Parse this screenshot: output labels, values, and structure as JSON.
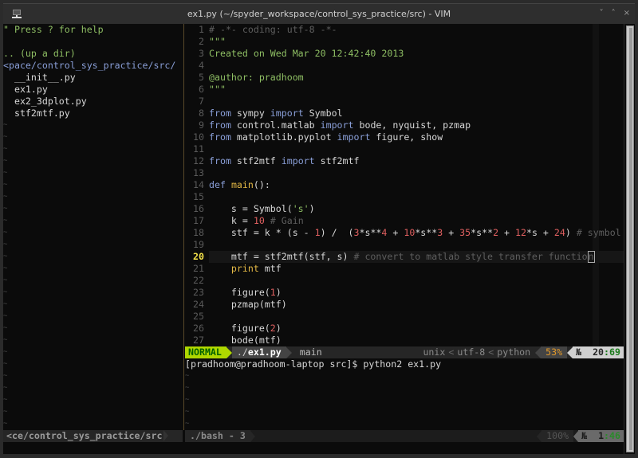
{
  "window": {
    "title": "ex1.py (~/spyder_workspace/control_sys_practice/src) - VIM",
    "controls": {
      "minimize": "˅",
      "maximize": "˄",
      "close": "×"
    }
  },
  "tree": {
    "help": "\" Press ? for help",
    "updir": ".. (up a dir)",
    "cwd": "<pace/control_sys_practice/src/",
    "files": [
      "  __init__.py",
      "  ex1.py",
      "  ex2_3dplot.py",
      "  stf2mtf.py"
    ],
    "tilde": "~"
  },
  "editor": {
    "current_line": 20,
    "lines": [
      {
        "n": "1",
        "tokens": [
          {
            "t": "# -*- coding: utf-8 -*-",
            "c": "com"
          }
        ]
      },
      {
        "n": "2",
        "tokens": [
          {
            "t": "\"\"\"",
            "c": "str"
          }
        ]
      },
      {
        "n": "3",
        "tokens": [
          {
            "t": "Created on Wed Mar 20 12:42:40 2013",
            "c": "str"
          }
        ]
      },
      {
        "n": "4",
        "tokens": []
      },
      {
        "n": "5",
        "tokens": [
          {
            "t": "@author: pradhoom",
            "c": "str"
          }
        ]
      },
      {
        "n": "6",
        "tokens": [
          {
            "t": "\"\"\"",
            "c": "str"
          }
        ]
      },
      {
        "n": "7",
        "tokens": []
      },
      {
        "n": "8",
        "tokens": [
          {
            "t": "from",
            "c": "kw"
          },
          {
            "t": " sympy ",
            "c": "pl"
          },
          {
            "t": "import",
            "c": "kw"
          },
          {
            "t": " Symbol",
            "c": "pl"
          }
        ]
      },
      {
        "n": "9",
        "tokens": [
          {
            "t": "from",
            "c": "kw"
          },
          {
            "t": " control.matlab ",
            "c": "pl"
          },
          {
            "t": "import",
            "c": "kw"
          },
          {
            "t": " bode, nyquist, pzmap",
            "c": "pl"
          }
        ]
      },
      {
        "n": "10",
        "tokens": [
          {
            "t": "from",
            "c": "kw"
          },
          {
            "t": " matplotlib.pyplot ",
            "c": "pl"
          },
          {
            "t": "import",
            "c": "kw"
          },
          {
            "t": " figure, show",
            "c": "pl"
          }
        ]
      },
      {
        "n": "11",
        "tokens": []
      },
      {
        "n": "12",
        "tokens": [
          {
            "t": "from",
            "c": "kw"
          },
          {
            "t": " stf2mtf ",
            "c": "pl"
          },
          {
            "t": "import",
            "c": "kw"
          },
          {
            "t": " stf2mtf",
            "c": "pl"
          }
        ]
      },
      {
        "n": "13",
        "tokens": []
      },
      {
        "n": "14",
        "tokens": [
          {
            "t": "def",
            "c": "kw"
          },
          {
            "t": " ",
            "c": "pl"
          },
          {
            "t": "main",
            "c": "fn"
          },
          {
            "t": "():",
            "c": "pl"
          }
        ]
      },
      {
        "n": "15",
        "tokens": []
      },
      {
        "n": "16",
        "tokens": [
          {
            "t": "    s = Symbol(",
            "c": "pl"
          },
          {
            "t": "'s'",
            "c": "str"
          },
          {
            "t": ")",
            "c": "pl"
          }
        ]
      },
      {
        "n": "17",
        "tokens": [
          {
            "t": "    k = ",
            "c": "pl"
          },
          {
            "t": "10",
            "c": "num"
          },
          {
            "t": " # Gain",
            "c": "com"
          }
        ]
      },
      {
        "n": "18",
        "tokens": [
          {
            "t": "    stf = k * (s - ",
            "c": "pl"
          },
          {
            "t": "1",
            "c": "num"
          },
          {
            "t": ") /  (",
            "c": "pl"
          },
          {
            "t": "3",
            "c": "num"
          },
          {
            "t": "*s**",
            "c": "pl"
          },
          {
            "t": "4",
            "c": "num"
          },
          {
            "t": " + ",
            "c": "pl"
          },
          {
            "t": "10",
            "c": "num"
          },
          {
            "t": "*s**",
            "c": "pl"
          },
          {
            "t": "3",
            "c": "num"
          },
          {
            "t": " + ",
            "c": "pl"
          },
          {
            "t": "35",
            "c": "num"
          },
          {
            "t": "*s**",
            "c": "pl"
          },
          {
            "t": "2",
            "c": "num"
          },
          {
            "t": " + ",
            "c": "pl"
          },
          {
            "t": "12",
            "c": "num"
          },
          {
            "t": "*s + ",
            "c": "pl"
          },
          {
            "t": "24",
            "c": "num"
          },
          {
            "t": ") ",
            "c": "pl"
          },
          {
            "t": "# symbol",
            "c": "com"
          }
        ]
      },
      {
        "n": "19",
        "tokens": []
      },
      {
        "n": "20",
        "tokens": [
          {
            "t": "    mtf = stf2mtf(stf, s) ",
            "c": "pl"
          },
          {
            "t": "# convert to matlab style transfer functio",
            "c": "com"
          },
          {
            "t": "n",
            "c": "cursor"
          }
        ]
      },
      {
        "n": "21",
        "tokens": [
          {
            "t": "    ",
            "c": "pl"
          },
          {
            "t": "print",
            "c": "fn"
          },
          {
            "t": " mtf",
            "c": "pl"
          }
        ]
      },
      {
        "n": "22",
        "tokens": []
      },
      {
        "n": "23",
        "tokens": [
          {
            "t": "    figure(",
            "c": "pl"
          },
          {
            "t": "1",
            "c": "num"
          },
          {
            "t": ")",
            "c": "pl"
          }
        ]
      },
      {
        "n": "24",
        "tokens": [
          {
            "t": "    pzmap(mtf)",
            "c": "pl"
          }
        ]
      },
      {
        "n": "25",
        "tokens": []
      },
      {
        "n": "26",
        "tokens": [
          {
            "t": "    figure(",
            "c": "pl"
          },
          {
            "t": "2",
            "c": "num"
          },
          {
            "t": ")",
            "c": "pl"
          }
        ]
      },
      {
        "n": "27",
        "tokens": [
          {
            "t": "    bode(mtf)",
            "c": "pl"
          }
        ]
      }
    ]
  },
  "statusline": {
    "mode": "NORMAL",
    "file_prefix": "./",
    "file_name": "ex1.py",
    "branch": "main",
    "fileformat": "unix",
    "encoding": "utf-8",
    "filetype": "python",
    "percent": "53%",
    "ln_icon": "№",
    "line": "20",
    "col": "69",
    "sep": "<"
  },
  "shell": {
    "prompt": "[pradhoom@pradhoom-laptop src]$ python2 ex1.py"
  },
  "bottom": {
    "left_path": "<ce/control_sys_practice/src",
    "right_name": "./bash - 3",
    "percent": "100%",
    "ln_icon": "№",
    "line": "1",
    "col": "46"
  }
}
